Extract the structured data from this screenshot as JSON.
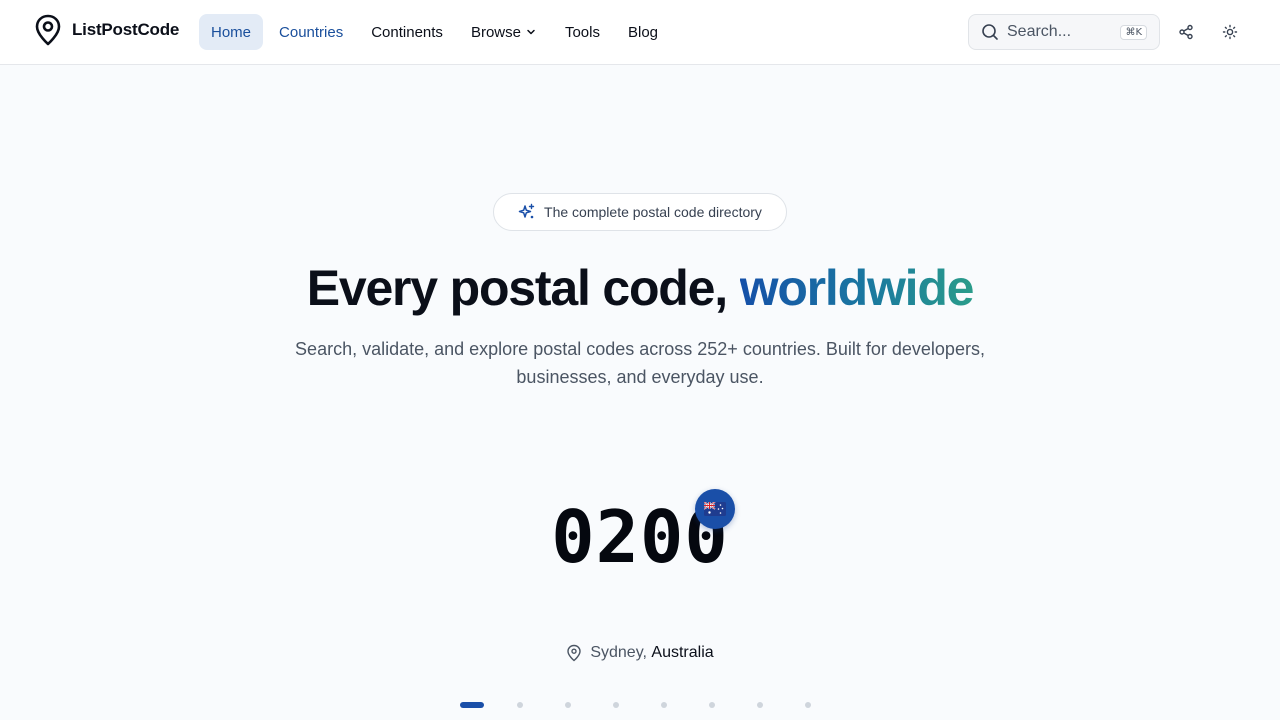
{
  "header": {
    "logo_text": "ListPostCode",
    "nav": [
      {
        "label": "Home"
      },
      {
        "label": "Countries"
      },
      {
        "label": "Continents"
      },
      {
        "label": "Browse"
      },
      {
        "label": "Tools"
      },
      {
        "label": "Blog"
      }
    ],
    "search": {
      "placeholder": "Search...",
      "shortcut": "⌘K"
    },
    "icons": {
      "search": "search-icon",
      "share": "share-icon",
      "theme": "sun-icon"
    }
  },
  "hero": {
    "badge": "The complete postal code directory",
    "headline_main": "Every postal code, ",
    "headline_accent": "worldwide",
    "subtitle": "Search, validate, and explore postal codes across 252+ countries. Built for developers, businesses, and everyday use.",
    "featured": {
      "code": "0200",
      "flag_emoji": "🇦🇺",
      "city": "Sydney",
      "country": "Australia"
    },
    "carousel": {
      "count": 8,
      "active": 0
    }
  },
  "colors": {
    "accent": "#1a4fa8",
    "gradient_start": "#1550a8",
    "gradient_end": "#2a9c8a",
    "background": "#f9fbfd"
  }
}
